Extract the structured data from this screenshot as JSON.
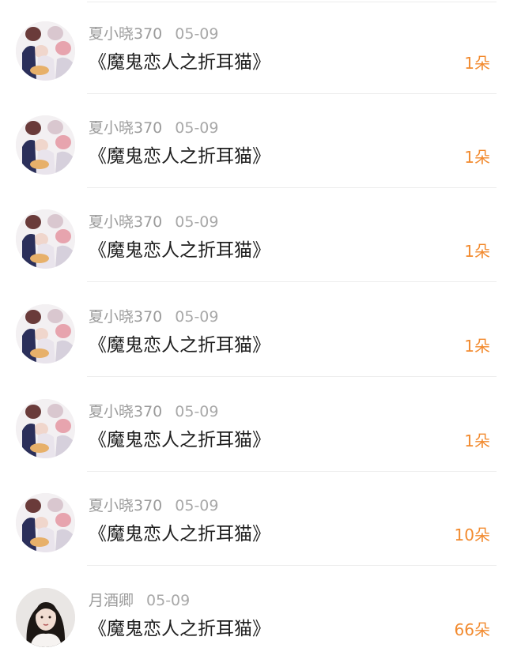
{
  "items": [
    {
      "username": "夏小晓370",
      "date": "05-09",
      "gift": "《魔鬼恋人之折耳猫》",
      "count": "1朵",
      "avatar": "anime-group-avatar-icon"
    },
    {
      "username": "夏小晓370",
      "date": "05-09",
      "gift": "《魔鬼恋人之折耳猫》",
      "count": "1朵",
      "avatar": "anime-group-avatar-icon"
    },
    {
      "username": "夏小晓370",
      "date": "05-09",
      "gift": "《魔鬼恋人之折耳猫》",
      "count": "1朵",
      "avatar": "anime-group-avatar-icon"
    },
    {
      "username": "夏小晓370",
      "date": "05-09",
      "gift": "《魔鬼恋人之折耳猫》",
      "count": "1朵",
      "avatar": "anime-group-avatar-icon"
    },
    {
      "username": "夏小晓370",
      "date": "05-09",
      "gift": "《魔鬼恋人之折耳猫》",
      "count": "1朵",
      "avatar": "anime-group-avatar-icon"
    },
    {
      "username": "夏小晓370",
      "date": "05-09",
      "gift": "《魔鬼恋人之折耳猫》",
      "count": "10朵",
      "avatar": "anime-group-avatar-icon"
    },
    {
      "username": "月酒卿",
      "date": "05-09",
      "gift": "《魔鬼恋人之折耳猫》",
      "count": "66朵",
      "avatar": "portrait-avatar-icon"
    }
  ],
  "colors": {
    "count": "#f28a2e",
    "username": "#9b9b9b",
    "gift_text": "#1f1f1f"
  }
}
